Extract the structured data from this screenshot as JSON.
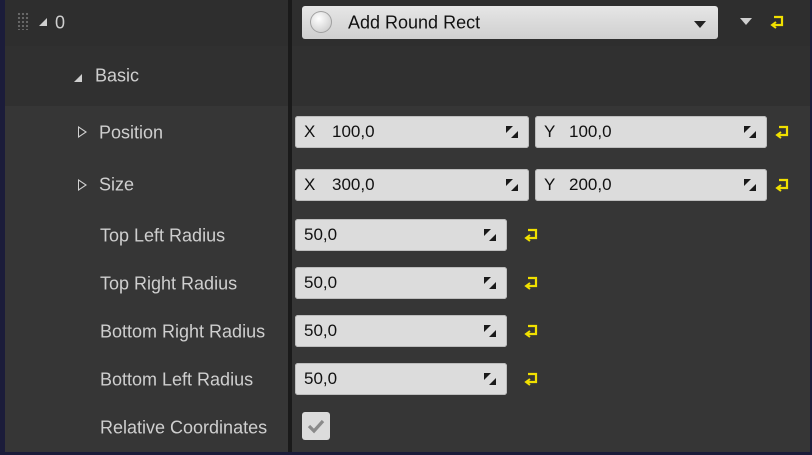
{
  "array_item": {
    "index_label": "0",
    "combo_value": "Add Round Rect"
  },
  "category": {
    "label": "Basic"
  },
  "properties": {
    "position": {
      "label": "Position",
      "x_axis": "X",
      "x_value": "100,0",
      "y_axis": "Y",
      "y_value": "100,0"
    },
    "size": {
      "label": "Size",
      "x_axis": "X",
      "x_value": "300,0",
      "y_axis": "Y",
      "y_value": "200,0"
    },
    "top_left_radius": {
      "label": "Top Left Radius",
      "value": "50,0"
    },
    "top_right_radius": {
      "label": "Top Right Radius",
      "value": "50,0"
    },
    "bottom_right_radius": {
      "label": "Bottom Right Radius",
      "value": "50,0"
    },
    "bottom_left_radius": {
      "label": "Bottom Left Radius",
      "value": "50,0"
    },
    "relative_coordinates": {
      "label": "Relative Coordinates",
      "checked": true
    }
  },
  "colors": {
    "panel_bg": "#363636",
    "field_bg": "#dcdcdc",
    "reset_arrow": "#f0e000",
    "text": "#cfcfcf"
  }
}
